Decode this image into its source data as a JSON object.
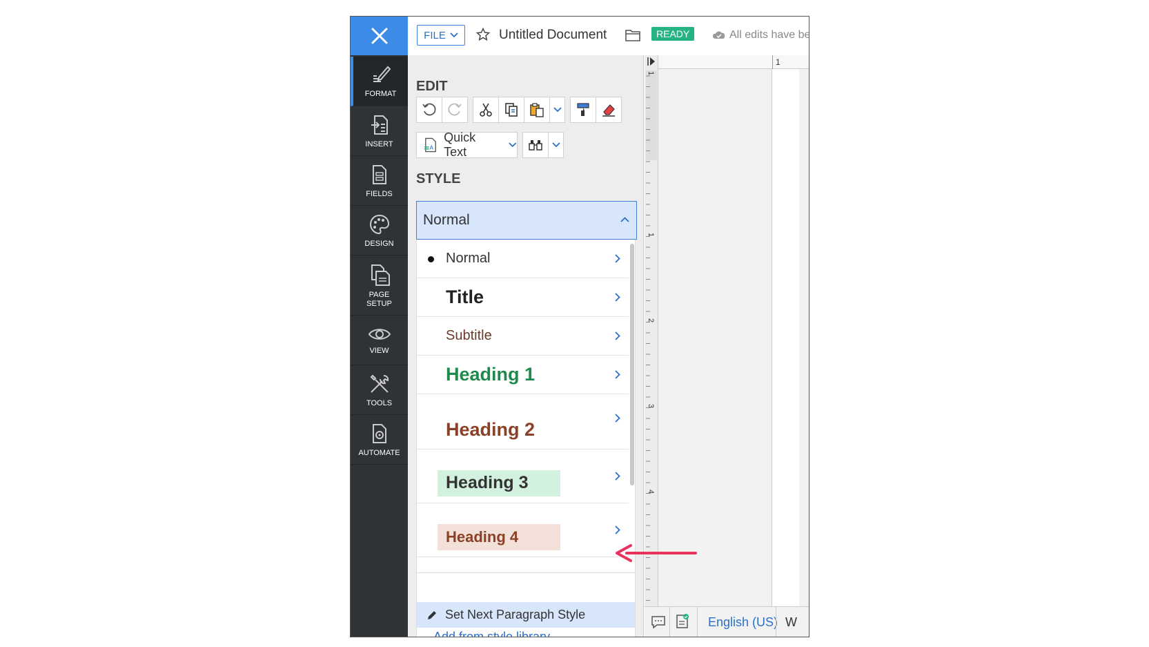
{
  "topbar": {
    "file_label": "FILE",
    "document_title": "Untitled Document",
    "status_badge": "READY",
    "save_status": "All edits have be"
  },
  "sidebar": {
    "items": [
      {
        "label": "FORMAT",
        "icon": "format-icon",
        "active": true
      },
      {
        "label": "INSERT",
        "icon": "insert-icon"
      },
      {
        "label": "FIELDS",
        "icon": "fields-icon"
      },
      {
        "label": "DESIGN",
        "icon": "palette-icon"
      },
      {
        "label": "PAGE SETUP",
        "icon": "page-setup-icon"
      },
      {
        "label": "VIEW",
        "icon": "eye-icon"
      },
      {
        "label": "TOOLS",
        "icon": "tools-icon"
      },
      {
        "label": "AUTOMATE",
        "icon": "automate-icon"
      }
    ]
  },
  "panel": {
    "edit_title": "EDIT",
    "quick_text_label": "Quick Text",
    "style_title": "STYLE",
    "style_selected": "Normal",
    "styles": [
      {
        "label": "Normal",
        "selected": true
      },
      {
        "label": "Title"
      },
      {
        "label": "Subtitle"
      },
      {
        "label": "Heading 1"
      },
      {
        "label": "Heading 2"
      },
      {
        "label": "Heading 3"
      },
      {
        "label": "Heading 4"
      }
    ],
    "set_next_label": "Set Next Paragraph Style",
    "add_library_label": "Add from style library"
  },
  "ruler": {
    "h_mark": "1",
    "v_marks": [
      "1",
      "1",
      "2",
      "3",
      "4"
    ]
  },
  "statusbar": {
    "language": "English (US)",
    "extra": "W"
  },
  "colors": {
    "accent": "#3d8be6",
    "sidebar": "#2f3236",
    "ready": "#25b383",
    "heading1": "#1e8a4c",
    "heading2": "#8a4127",
    "heading3_bg": "#d3f1df",
    "heading4_bg": "#f3e1d9",
    "arrow": "#e8335f"
  }
}
